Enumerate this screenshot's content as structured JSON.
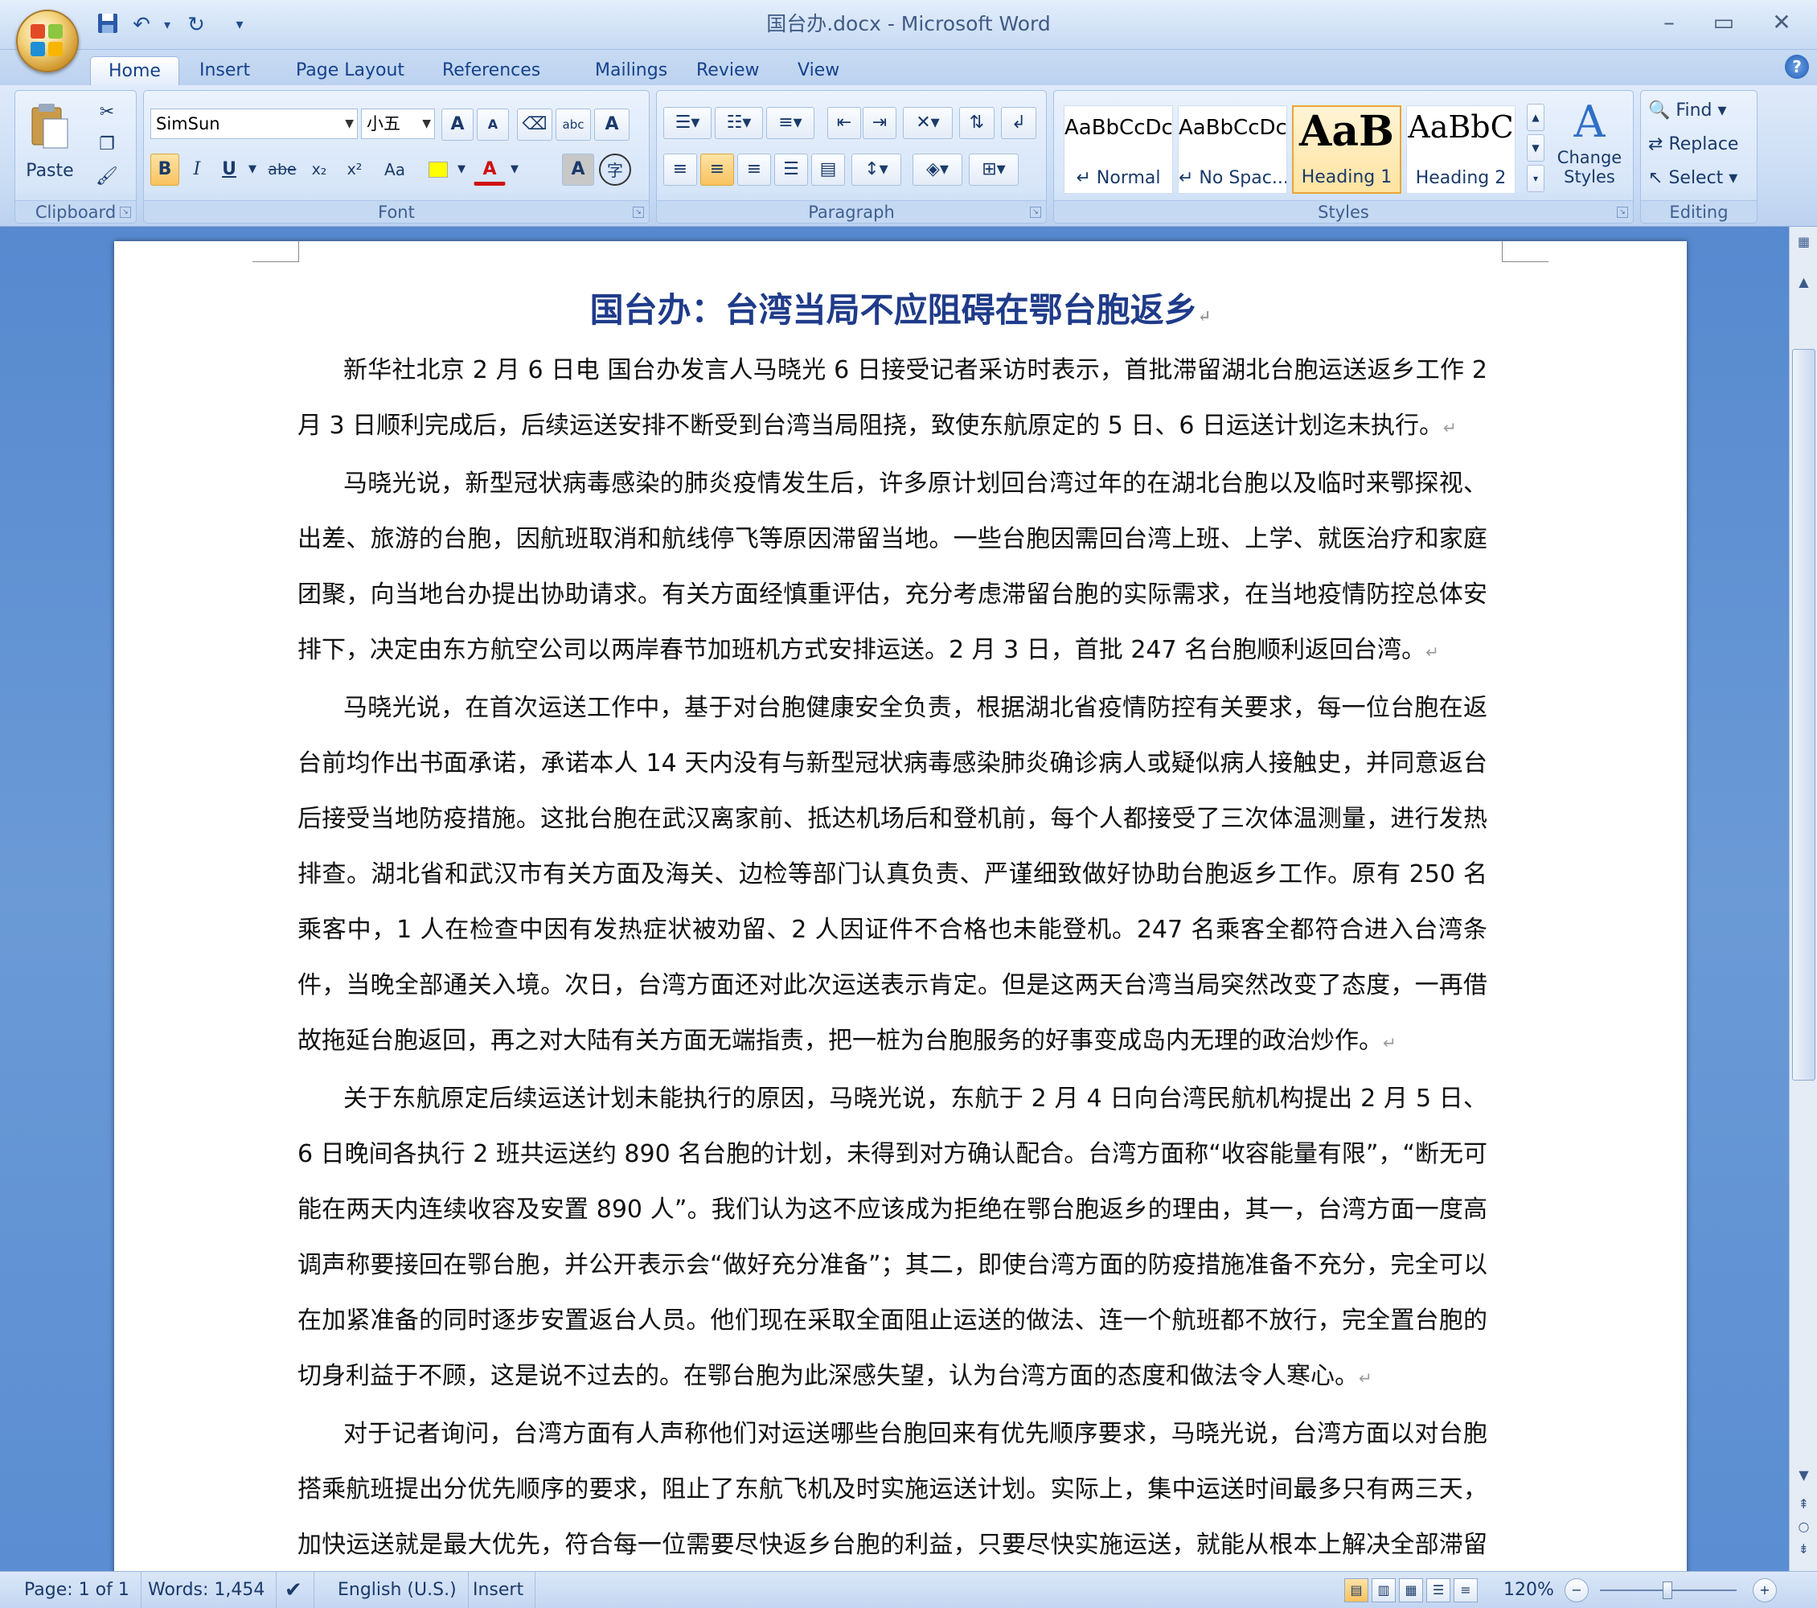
{
  "window": {
    "title": "国台办.docx - Microsoft Word",
    "controls": {
      "minimize": "–",
      "maximize": "▭",
      "close": "✕"
    }
  },
  "qat": {
    "save_icon": "save-icon",
    "undo_icon": "undo-icon",
    "redo_icon": "redo-icon",
    "customize": "▾"
  },
  "tabs": [
    "Home",
    "Insert",
    "Page Layout",
    "References",
    "Mailings",
    "Review",
    "View"
  ],
  "active_tab": "Home",
  "ribbon": {
    "clipboard": {
      "label": "Clipboard",
      "paste": "Paste"
    },
    "font": {
      "label": "Font",
      "font_name": "SimSun",
      "font_size": "小五",
      "grow": "A",
      "shrink": "A",
      "bold": "B",
      "italic": "I",
      "underline": "U",
      "strike": "abe",
      "subscript": "x₂",
      "superscript": "x²",
      "change_case": "Aa",
      "font_color": "A",
      "char_shading": "A",
      "enclose": "字"
    },
    "paragraph": {
      "label": "Paragraph"
    },
    "styles": {
      "label": "Styles",
      "items": [
        {
          "sample": "AaBbCcDc",
          "name": "↵ Normal"
        },
        {
          "sample": "AaBbCcDc",
          "name": "↵ No Spac..."
        },
        {
          "sample": "AaB",
          "name": "Heading 1"
        },
        {
          "sample": "AaBbC",
          "name": "Heading 2"
        }
      ],
      "change_styles": "Change Styles"
    },
    "editing": {
      "label": "Editing",
      "find": "Find",
      "replace": "Replace",
      "select": "Select"
    }
  },
  "document": {
    "heading": "国台办：台湾当局不应阻碍在鄂台胞返乡",
    "paragraphs": [
      "新华社北京 2 月 6 日电 国台办发言人马晓光 6 日接受记者采访时表示，首批滞留湖北台胞运送返乡工作 2 月 3 日顺利完成后，后续运送安排不断受到台湾当局阻挠，致使东航原定的 5 日、6 日运送计划迄未执行。",
      "马晓光说，新型冠状病毒感染的肺炎疫情发生后，许多原计划回台湾过年的在湖北台胞以及临时来鄂探视、出差、旅游的台胞，因航班取消和航线停飞等原因滞留当地。一些台胞因需回台湾上班、上学、就医治疗和家庭团聚，向当地台办提出协助请求。有关方面经慎重评估，充分考虑滞留台胞的实际需求，在当地疫情防控总体安排下，决定由东方航空公司以两岸春节加班机方式安排运送。2 月 3 日，首批 247 名台胞顺利返回台湾。",
      "马晓光说，在首次运送工作中，基于对台胞健康安全负责，根据湖北省疫情防控有关要求，每一位台胞在返台前均作出书面承诺，承诺本人 14 天内没有与新型冠状病毒感染肺炎确诊病人或疑似病人接触史，并同意返台后接受当地防疫措施。这批台胞在武汉离家前、抵达机场后和登机前，每个人都接受了三次体温测量，进行发热排查。湖北省和武汉市有关方面及海关、边检等部门认真负责、严谨细致做好协助台胞返乡工作。原有 250 名乘客中，1 人在检查中因有发热症状被劝留、2 人因证件不合格也未能登机。247 名乘客全都符合进入台湾条件，当晚全部通关入境。次日，台湾方面还对此次运送表示肯定。但是这两天台湾当局突然改变了态度，一再借故拖延台胞返回，再之对大陆有关方面无端指责，把一桩为台胞服务的好事变成岛内无理的政治炒作。",
      "关于东航原定后续运送计划未能执行的原因，马晓光说，东航于 2 月 4 日向台湾民航机构提出 2 月 5 日、6 日晚间各执行 2 班共运送约 890 名台胞的计划，未得到对方确认配合。台湾方面称“收容能量有限”，“断无可能在两天内连续收容及安置 890 人”。我们认为这不应该成为拒绝在鄂台胞返乡的理由，其一，台湾方面一度高调声称要接回在鄂台胞，并公开表示会“做好充分准备”；其二，即使台湾方面的防疫措施准备不充分，完全可以在加紧准备的同时逐步安置返台人员。他们现在采取全面阻止运送的做法、连一个航班都不放行，完全置台胞的切身利益于不顾，这是说不过去的。在鄂台胞为此深感失望，认为台湾方面的态度和做法令人寒心。",
      "对于记者询问，台湾方面有人声称他们对运送哪些台胞回来有优先顺序要求，马晓光说，台湾方面以对台胞搭乘航班提出分优先顺序的要求，阻止了东航飞机及时实施运送计划。实际上，集中运送时间最多只有两三天，加快运送就是最大优先，符合每一位需要尽快返乡台胞的利益，只要尽快实施运送，就能从根本上解决全部滞留台胞急需返乡的最大"
    ],
    "paragraph_mark": "↵"
  },
  "status": {
    "page": "Page: 1 of 1",
    "words": "Words: 1,454",
    "language": "English (U.S.)",
    "mode": "Insert",
    "zoom": "120%"
  },
  "colors": {
    "heading": "#1f3b8a",
    "ribbon": "#dfeafa",
    "frame": "#5a8fd0"
  }
}
